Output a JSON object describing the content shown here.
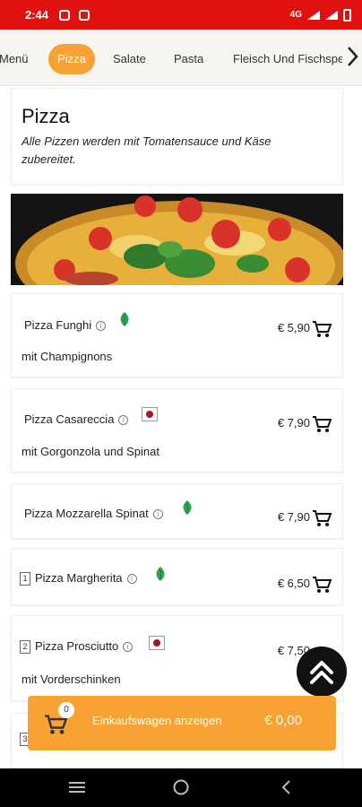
{
  "status": {
    "time": "2:44",
    "network": "4G"
  },
  "categories": [
    "Menü",
    "Pizza",
    "Salate",
    "Pasta",
    "Fleisch Und Fischspeisen"
  ],
  "header": {
    "title": "Pizza",
    "description": "Alle Pizzen werden mit Tomatensauce und Käse zubereitet."
  },
  "items": [
    {
      "name": "Pizza Funghi",
      "desc": "mit Champignons",
      "price": "€ 5,90",
      "badge": "veg"
    },
    {
      "name": "Pizza Casareccia",
      "desc": "mit Gorgonzola und Spinat",
      "price": "€ 7,90",
      "badge": "meat"
    },
    {
      "name": "Pizza Mozzarella Spinat",
      "price": "€ 7,90",
      "badge": "veg"
    },
    {
      "name": "Pizza Margherita",
      "price": "€ 6,50",
      "badge": "veg",
      "number": "1"
    },
    {
      "name": "Pizza Prosciutto",
      "desc": "mit Vorderschinken",
      "price": "€ 7,50",
      "badge": "meat",
      "number": "2"
    },
    {
      "number": "3"
    }
  ],
  "cart": {
    "count": "0",
    "label": "Einkaufswagen anzeigen",
    "total": "€ 0,00"
  },
  "colors": {
    "status_bar": "#e0120f",
    "accent": "#f7a233",
    "veg": "#2ea44f",
    "meat": "#a8142a"
  },
  "icons": [
    "nav-next-icon",
    "info-icon",
    "veg-leaf-icon",
    "meat-badge-icon",
    "cart-icon",
    "scroll-top-icon",
    "recent-apps-icon",
    "home-icon",
    "back-icon"
  ]
}
